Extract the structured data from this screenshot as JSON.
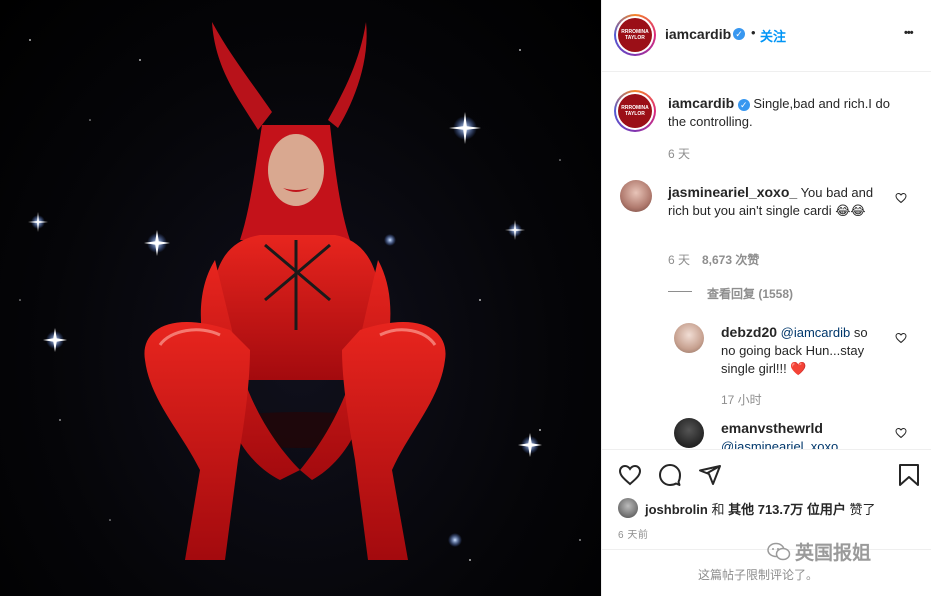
{
  "post": {
    "author": "iamcardib",
    "avatar_text": "RRROMINA\nTAYLOR",
    "follow_label": "关注",
    "verified_mark": "✓",
    "more_label": "•••"
  },
  "caption": {
    "username": "iamcardib",
    "text": "Single,bad and rich.I do the controlling.",
    "time": "6 天"
  },
  "comments": [
    {
      "username": "jasmineariel_xoxo_",
      "text": " You bad and rich but you ain't single cardi 😂😂",
      "time": "6 天",
      "likes": "8,673 次赞",
      "view_replies": "查看回复 (1558)"
    }
  ],
  "replies": [
    {
      "username": "debzd20",
      "mention": "@iamcardib",
      "text": " so no going back Hun...stay single girl!!! ❤️",
      "time": "17 小时"
    },
    {
      "username": "emanvsthewrld",
      "mention": "@jasmineariel_xoxo_",
      "text": ""
    }
  ],
  "likes_line": {
    "user": "joshbrolin",
    "and": "和",
    "others": "其他 713.7万 位用户",
    "suffix": "赞了"
  },
  "post_time": "6 天前",
  "restricted_comments": "这篇帖子限制评论了。",
  "watermark": "英国报姐",
  "icons": [
    "heart-icon",
    "comment-icon",
    "share-icon",
    "bookmark-icon",
    "more-icon",
    "verified-icon"
  ],
  "colors": {
    "accent": "#0095f6",
    "verified": "#3897f0",
    "heart_red": "#ed4956",
    "costume_red": "#d4141a"
  }
}
